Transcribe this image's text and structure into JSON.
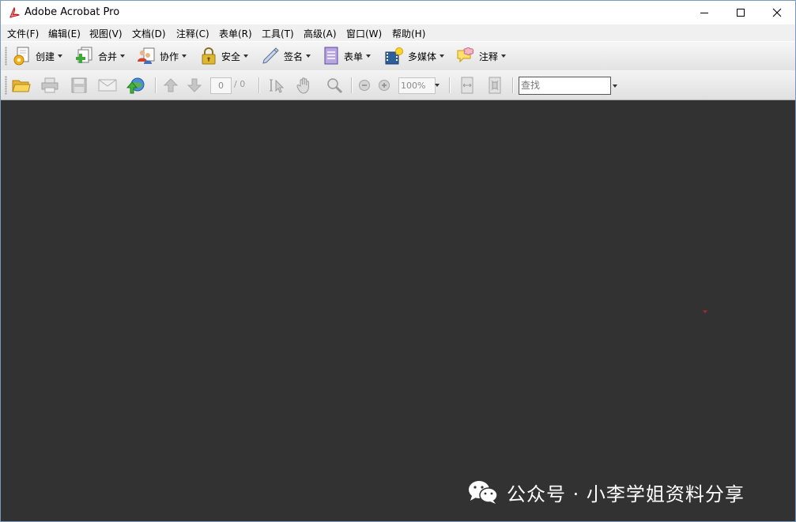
{
  "window": {
    "title": "Adobe Acrobat Pro"
  },
  "menu": [
    {
      "label": "文件(F)"
    },
    {
      "label": "编辑(E)"
    },
    {
      "label": "视图(V)"
    },
    {
      "label": "文档(D)"
    },
    {
      "label": "注释(C)"
    },
    {
      "label": "表单(R)"
    },
    {
      "label": "工具(T)"
    },
    {
      "label": "高级(A)"
    },
    {
      "label": "窗口(W)"
    },
    {
      "label": "帮助(H)"
    }
  ],
  "tasks": [
    {
      "label": "创建",
      "icon": "create-icon"
    },
    {
      "label": "合并",
      "icon": "combine-icon"
    },
    {
      "label": "协作",
      "icon": "collaborate-icon"
    },
    {
      "label": "安全",
      "icon": "lock-icon"
    },
    {
      "label": "签名",
      "icon": "pen-icon"
    },
    {
      "label": "表单",
      "icon": "form-icon"
    },
    {
      "label": "多媒体",
      "icon": "multimedia-icon"
    },
    {
      "label": "注释",
      "icon": "comment-icon"
    }
  ],
  "toolbar": {
    "page_number": "0",
    "page_total": "/ 0",
    "zoom": "100%",
    "search_placeholder": "查找"
  },
  "watermark": {
    "text": "公众号 · 小李学姐资料分享",
    "icon": "wechat-icon"
  },
  "colors": {
    "document_background": "#323232",
    "title_icon": "#c8161d"
  }
}
